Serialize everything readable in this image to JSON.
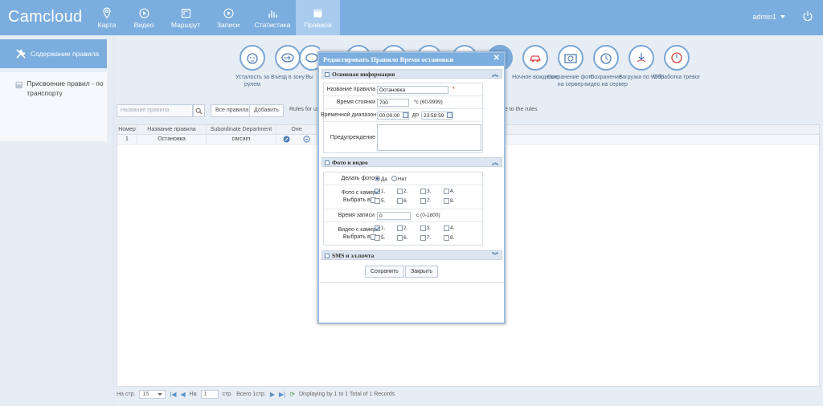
{
  "app": {
    "title": "Camcloud"
  },
  "nav": [
    {
      "label": "Карта",
      "icon": "map-pin-icon"
    },
    {
      "label": "Видео",
      "icon": "play-circle-icon"
    },
    {
      "label": "Маршрут",
      "icon": "route-icon"
    },
    {
      "label": "Записи",
      "icon": "record-icon"
    },
    {
      "label": "Статистика",
      "icon": "bar-chart-icon"
    },
    {
      "label": "Правила",
      "icon": "rules-icon",
      "active": true
    }
  ],
  "user": {
    "name": "admin1"
  },
  "sidebar": {
    "items": [
      {
        "label": "Содержание правила",
        "icon": "tools-icon",
        "active": true
      },
      {
        "label": "Присвоение правил - по транспорту",
        "icon": "assign-icon"
      }
    ]
  },
  "rule_types": [
    {
      "label": "Усталость за рулем",
      "icon": "fatigue-icon"
    },
    {
      "label": "Въезд в зону",
      "icon": "zone-entry-icon"
    },
    {
      "label": "Вы",
      "icon": "zone-exit-icon"
    },
    {
      "label": "",
      "icon": "speed-icon"
    },
    {
      "label": "",
      "icon": "parking-icon"
    },
    {
      "label": "",
      "icon": "rule-icon"
    },
    {
      "label": "",
      "icon": "rule2-icon"
    },
    {
      "label": "",
      "icon": "selected-rule-icon"
    },
    {
      "label": "Ночное вождение",
      "icon": "night-driving-icon"
    },
    {
      "label": "Сохранение фото на сервер",
      "icon": "camera-icon"
    },
    {
      "label": "Сохранение видео на сервер",
      "icon": "video-save-icon"
    },
    {
      "label": "Загрузка по Wi-Fi",
      "icon": "wifi-download-icon"
    },
    {
      "label": "Обработка тревог",
      "icon": "alarm-handling-icon"
    }
  ],
  "toolbar": {
    "search_placeholder": "Название правила",
    "all_rules": "Все правила",
    "add": "Добавить",
    "rules_for_users": "Rules for users",
    "delete_suffix": "e to the rules"
  },
  "grid": {
    "columns": [
      "Номер",
      "Название правила",
      "Subordinate Department",
      "Оне"
    ],
    "rows": [
      {
        "num": "1",
        "name": "Остановка",
        "dept": "carcam"
      }
    ]
  },
  "pager": {
    "per_page_label": "На стр.",
    "per_page": "15",
    "page_label": "На",
    "page": "1",
    "page_suffix": "стр.",
    "total_pages": "Всего 1стр.",
    "summary": "Displaying by 1 to 1 Total of 1 Records"
  },
  "dialog": {
    "title": "Редактировать   Правило Время остановки",
    "close": "✕",
    "basic_section": "Основная информация",
    "rule_name_label": "Название правила",
    "rule_name": "Остановка",
    "required": "*",
    "stop_time_label": "Время стоянки",
    "stop_time": "700",
    "stop_time_hint": "*с (60-9999)",
    "time_range_label": "Временной диапазон",
    "time_from": "00:00:00",
    "time_to_label": "до",
    "time_to": "23:59:59",
    "warning_label": "Предупреждение",
    "warning": "",
    "media_section": "Фото и видео",
    "take_photo_label": "Делать фото",
    "yes": "Да",
    "no": "Нет",
    "photo_cam_label": "Фото с камер",
    "select_all_label": "Выбрать все",
    "record_time_label": "Время записи",
    "record_time": "0",
    "record_time_hint": "с (0-1800)",
    "video_cam_label": "Видео с камер",
    "sms_section": "SMS и эл.почта",
    "save": "Сохранить",
    "close_btn": "Закрыть",
    "cams": [
      "1.",
      "2.",
      "3.",
      "4.",
      "5.",
      "6.",
      "7.",
      "8."
    ]
  },
  "colors": {
    "header": "#7badde",
    "active_nav": "#a9cbee",
    "accent": "#4f7fb8"
  }
}
